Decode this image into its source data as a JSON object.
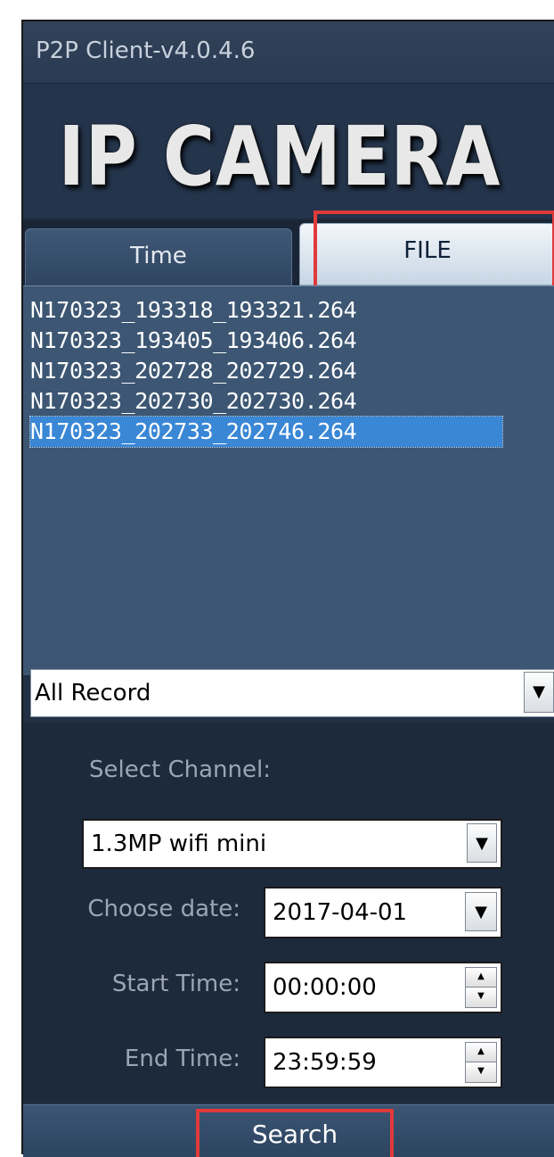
{
  "window": {
    "title": "P2P Client-v4.0.4.6"
  },
  "banner": {
    "title": "IP CAMERA"
  },
  "tabs": [
    {
      "label": "Time",
      "active": false
    },
    {
      "label": "FILE",
      "active": true
    }
  ],
  "files": [
    {
      "name": "N170323_193318_193321.264",
      "selected": false
    },
    {
      "name": "N170323_193405_193406.264",
      "selected": false
    },
    {
      "name": "N170323_202728_202729.264",
      "selected": false
    },
    {
      "name": "N170323_202730_202730.264",
      "selected": false
    },
    {
      "name": "N170323_202733_202746.264",
      "selected": true
    }
  ],
  "record_filter": {
    "value": "All Record",
    "arrow": "▼"
  },
  "form": {
    "channel_label": "Select Channel:",
    "channel_value": "1.3MP wifi mini",
    "date_label": "Choose date:",
    "date_value": "2017-04-01",
    "start_label": "Start Time:",
    "start_value": "00:00:00",
    "end_label": "End Time:",
    "end_value": "23:59:59"
  },
  "search_button": {
    "label": "Search"
  },
  "colors": {
    "panel": "#213044",
    "list_background": "#3c5673",
    "selection": "#3a87d6",
    "highlight_box": "#e03a3a"
  }
}
